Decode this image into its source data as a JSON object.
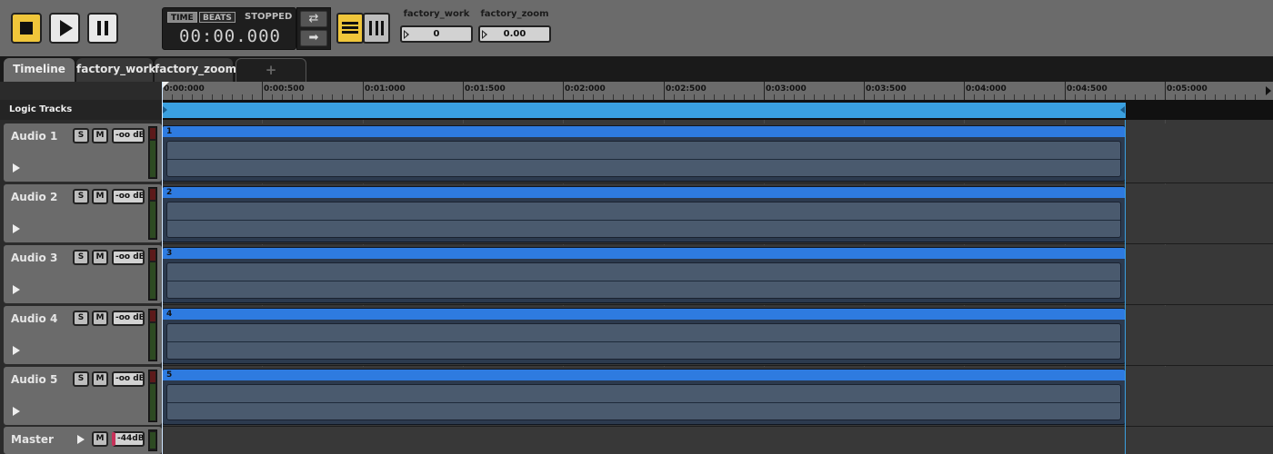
{
  "transport": {
    "mode_time": "TIME",
    "mode_beats": "BEATS",
    "status": "STOPPED",
    "time": "00:00.000",
    "loop_icon": "loop-icon",
    "next_icon": "arrow-right-icon"
  },
  "params": [
    {
      "label": "factory_work",
      "value": "0"
    },
    {
      "label": "factory_zoom",
      "value": "0.00"
    }
  ],
  "tabs": [
    "Timeline",
    "factory_work",
    "factory_zoom",
    "+"
  ],
  "logic_tracks_label": "Logic Tracks",
  "tracks": [
    {
      "name": "Audio 1",
      "solo": "S",
      "mute": "M",
      "volume": "-oo dB",
      "clip": "1"
    },
    {
      "name": "Audio 2",
      "solo": "S",
      "mute": "M",
      "volume": "-oo dB",
      "clip": "2"
    },
    {
      "name": "Audio 3",
      "solo": "S",
      "mute": "M",
      "volume": "-oo dB",
      "clip": "3"
    },
    {
      "name": "Audio 4",
      "solo": "S",
      "mute": "M",
      "volume": "-oo dB",
      "clip": "4"
    },
    {
      "name": "Audio 5",
      "solo": "S",
      "mute": "M",
      "volume": "-oo dB",
      "clip": "5"
    }
  ],
  "master": {
    "name": "Master",
    "mute": "M",
    "volume": "-44dB"
  },
  "ruler": [
    "0:00:000",
    "0:00:500",
    "0:01:000",
    "0:01:500",
    "0:02:000",
    "0:02:500",
    "0:03:000",
    "0:03:500",
    "0:04:000",
    "0:04:500",
    "0:05:000"
  ],
  "colors": {
    "accent": "#f0c63a",
    "clip": "#2e7be0",
    "loop": "#3aa0e0"
  }
}
